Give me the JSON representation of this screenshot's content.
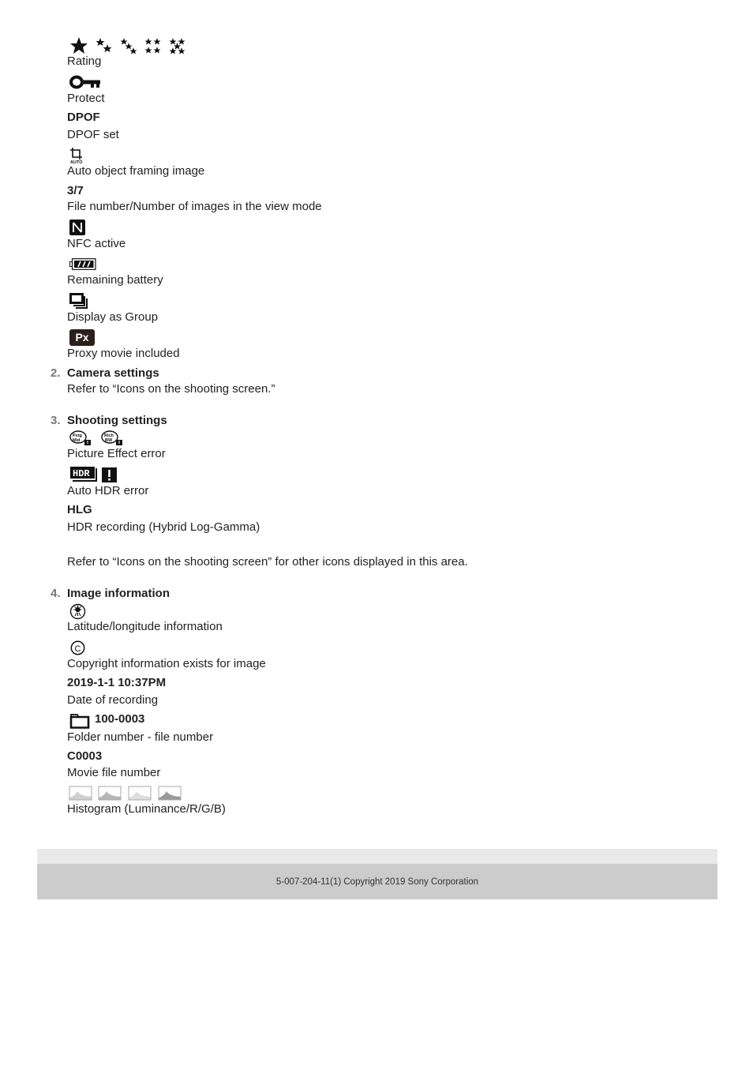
{
  "section1_items": [
    {
      "icon": "rating-stars-icon",
      "label": "Rating"
    },
    {
      "icon": "protect-key-icon",
      "label": "Protect"
    },
    {
      "value": "DPOF",
      "label": "DPOF set"
    },
    {
      "icon": "auto-object-framing-icon",
      "icon_text": "AUTO",
      "label": "Auto object framing image"
    },
    {
      "value": "3/7",
      "label": "File number/Number of images in the view mode"
    },
    {
      "icon": "nfc-icon",
      "label": "NFC active"
    },
    {
      "icon": "battery-icon",
      "label": "Remaining battery"
    },
    {
      "icon": "display-as-group-icon",
      "label": "Display as Group"
    },
    {
      "icon": "proxy-movie-icon",
      "icon_text": "Px",
      "label": "Proxy movie included"
    }
  ],
  "sections": [
    {
      "number": "2.",
      "title": "Camera settings",
      "text": "Refer to “Icons on the shooting screen.”"
    },
    {
      "number": "3.",
      "title": "Shooting settings",
      "items": [
        {
          "icon": "picture-effect-error-icon",
          "icon_texts": [
            "Pstg Mid",
            "Rich BW"
          ],
          "label": "Picture Effect error"
        },
        {
          "icon": "auto-hdr-error-icon",
          "icon_texts": [
            "HDR",
            "!"
          ],
          "label": "Auto HDR error"
        },
        {
          "value": "HLG",
          "label": "HDR recording (Hybrid Log-Gamma)"
        }
      ],
      "note": "Refer to “Icons on the shooting screen” for other icons displayed in this area."
    },
    {
      "number": "4.",
      "title": "Image information",
      "items": [
        {
          "icon": "gps-icon",
          "label": "Latitude/longitude information"
        },
        {
          "icon": "copyright-icon",
          "icon_text": "C",
          "label": "Copyright information exists for image"
        },
        {
          "value": "2019-1-1 10:37PM",
          "label": "Date of recording"
        },
        {
          "icon": "folder-icon",
          "value": "100-0003",
          "label": "Folder number - file number"
        },
        {
          "value": "C0003",
          "label": "Movie file number"
        },
        {
          "icon": "histogram-icon",
          "label": "Histogram (Luminance/R/G/B)"
        }
      ]
    }
  ],
  "footer": {
    "text": "5-007-204-11(1) Copyright 2019 Sony Corporation"
  }
}
